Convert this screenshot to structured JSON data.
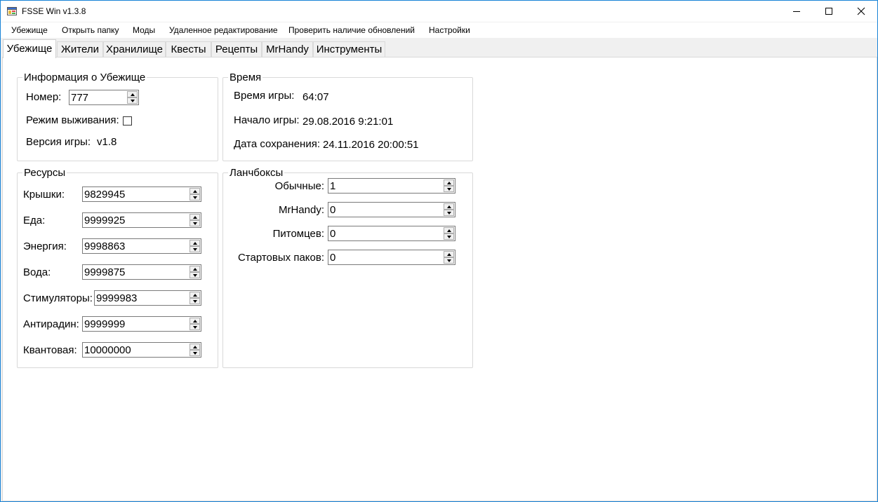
{
  "window": {
    "title": "FSSE Win v1.3.8"
  },
  "menu": [
    "Убежище",
    "Открыть папку",
    "Моды",
    "Удаленное редактирование",
    "Проверить наличие обновлений",
    "Настройки"
  ],
  "tabs": [
    "Убежище",
    "Жители",
    "Хранилище",
    "Квесты",
    "Рецепты",
    "MrHandy",
    "Инструменты"
  ],
  "active_tab": "Убежище",
  "vault_info": {
    "title": "Информация о Убежище",
    "number_label": "Номер:",
    "number_value": "777",
    "survival_label": "Режим выживания:",
    "survival_checked": false,
    "version_label": "Версия игры:",
    "version_value": "v1.8"
  },
  "time": {
    "title": "Время",
    "game_time_label": "Время игры:",
    "game_time_value": "64:07",
    "start_label": "Начало игры:",
    "start_value": "29.08.2016 9:21:01",
    "save_label": "Дата сохранения:",
    "save_value": "24.11.2016 20:00:51"
  },
  "resources": {
    "title": "Ресурсы",
    "items": [
      {
        "label": "Крышки:",
        "value": "9829945"
      },
      {
        "label": "Еда:",
        "value": "9999925"
      },
      {
        "label": "Энергия:",
        "value": "9998863"
      },
      {
        "label": "Вода:",
        "value": "9999875"
      },
      {
        "label": "Стимуляторы:",
        "value": "9999983"
      },
      {
        "label": "Антирадин:",
        "value": "9999999"
      },
      {
        "label": "Квантовая:",
        "value": "10000000"
      }
    ]
  },
  "lunchboxes": {
    "title": "Ланчбоксы",
    "items": [
      {
        "label": "Обычные:",
        "value": "1"
      },
      {
        "label": "MrHandy:",
        "value": "0"
      },
      {
        "label": "Питомцев:",
        "value": "0"
      },
      {
        "label": "Стартовых паков:",
        "value": "0"
      }
    ]
  },
  "colors": {
    "window_border": "#1883d7",
    "accent": "#0078d7"
  }
}
